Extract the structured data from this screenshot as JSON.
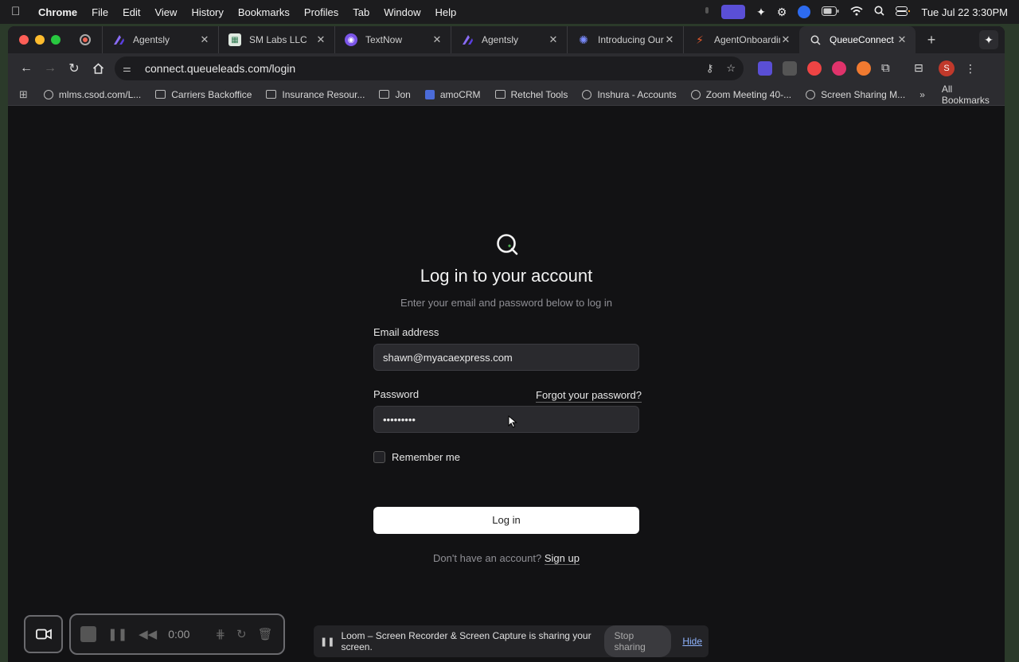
{
  "menubar": {
    "app": "Chrome",
    "items": [
      "File",
      "Edit",
      "View",
      "History",
      "Bookmarks",
      "Profiles",
      "Tab",
      "Window",
      "Help"
    ],
    "clock": "Tue Jul 22  3:30PM"
  },
  "tabs": [
    {
      "label": "Agentsly",
      "favicon_color": "#6a4cf0"
    },
    {
      "label": "SM Labs LLC",
      "favicon_color": "#3aa86b"
    },
    {
      "label": "TextNow",
      "favicon_color": "#7b55e8"
    },
    {
      "label": "Agentsly",
      "favicon_color": "#6a4cf0"
    },
    {
      "label": "Introducing Our N",
      "favicon_color": "#4b6bd8"
    },
    {
      "label": "AgentOnboarding",
      "favicon_color": "#e55a2b"
    },
    {
      "label": "QueueConnect",
      "favicon_color": "#2c2c30"
    }
  ],
  "address_bar": {
    "url": "connect.queueleads.com/login"
  },
  "bookmarks": [
    {
      "label": "mlms.csod.com/L...",
      "icon": "globe-icon"
    },
    {
      "label": "Carriers Backoffice",
      "icon": "folder-icon"
    },
    {
      "label": "Insurance Resour...",
      "icon": "folder-icon"
    },
    {
      "label": "Jon",
      "icon": "folder-icon"
    },
    {
      "label": "amoCRM",
      "icon": "amocrm-icon"
    },
    {
      "label": "Retchel Tools",
      "icon": "folder-icon"
    },
    {
      "label": "Inshura - Accounts",
      "icon": "globe-icon"
    },
    {
      "label": "Zoom Meeting 40-...",
      "icon": "globe-icon"
    },
    {
      "label": "Screen Sharing M...",
      "icon": "globe-icon"
    }
  ],
  "bookmarks_more": "»",
  "all_bookmarks": "All Bookmarks",
  "login": {
    "title": "Log in to your account",
    "subtitle": "Enter your email and password below to log in",
    "email_label": "Email address",
    "email_value": "shawn@myacaexpress.com",
    "password_label": "Password",
    "password_value": "•••••••••",
    "forgot": "Forgot your password?",
    "remember": "Remember me",
    "submit": "Log in",
    "no_account": "Don't have an account?",
    "signup": "Sign up"
  },
  "loom": {
    "time": "0:00",
    "share_message": "Loom – Screen Recorder & Screen Capture is sharing your screen.",
    "stop_sharing": "Stop sharing",
    "hide": "Hide"
  },
  "profile_initial": "S"
}
